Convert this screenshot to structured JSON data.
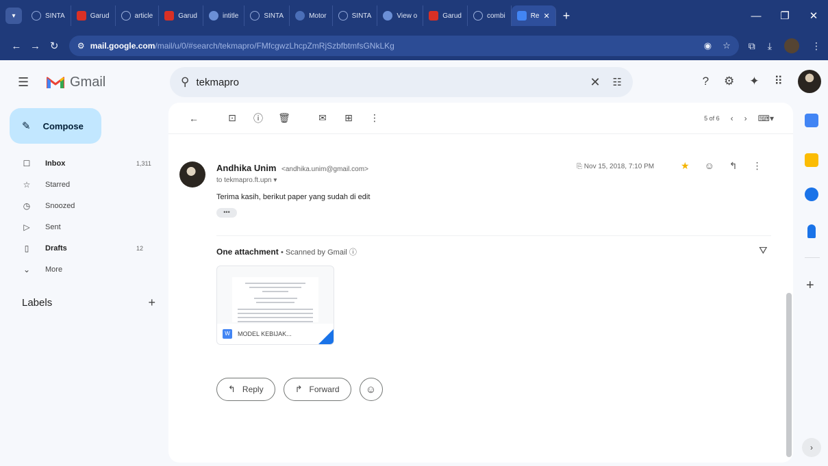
{
  "browser": {
    "tabs": [
      {
        "label": "SINTA",
        "icon": "sinta"
      },
      {
        "label": "Garud",
        "icon": "garuda"
      },
      {
        "label": "article",
        "icon": "art"
      },
      {
        "label": "Garud",
        "icon": "garuda"
      },
      {
        "label": "intitle",
        "icon": "web"
      },
      {
        "label": "SINTA",
        "icon": "sinta"
      },
      {
        "label": "Motor",
        "icon": "moto"
      },
      {
        "label": "SINTA",
        "icon": "sinta"
      },
      {
        "label": "View o",
        "icon": "web"
      },
      {
        "label": "Garud",
        "icon": "garuda"
      },
      {
        "label": "combi",
        "icon": "art"
      }
    ],
    "active_tab": {
      "label": "Re"
    },
    "url_host": "mail.google.com",
    "url_path": "/mail/u/0/#search/tekmapro/FMfcgwzLhcpZmRjSzbfbtmfsGNkLKg"
  },
  "gmail": {
    "logo_text": "Gmail",
    "search_value": "tekmapro",
    "compose_label": "Compose",
    "nav": [
      {
        "icon": "inbox-icon",
        "glyph": "☐",
        "label": "Inbox",
        "count": "1,311",
        "bold": true
      },
      {
        "icon": "star-icon",
        "glyph": "☆",
        "label": "Starred",
        "count": "",
        "bold": false
      },
      {
        "icon": "clock-icon",
        "glyph": "◷",
        "label": "Snoozed",
        "count": "",
        "bold": false
      },
      {
        "icon": "send-icon",
        "glyph": "▷",
        "label": "Sent",
        "count": "",
        "bold": false
      },
      {
        "icon": "draft-icon",
        "glyph": "▯",
        "label": "Drafts",
        "count": "12",
        "bold": true
      },
      {
        "icon": "chevron-down-icon",
        "glyph": "⌄",
        "label": "More",
        "count": "",
        "bold": false
      }
    ],
    "labels_heading": "Labels",
    "pager_text": "5 of 6"
  },
  "message": {
    "sender_name": "Andhika Unim",
    "sender_email": "<andhika.unim@gmail.com>",
    "to_line": "to tekmapro.ft.upn",
    "date": "Nov 15, 2018, 7:10 PM",
    "body": "Terima kasih, berikut paper yang sudah di edit",
    "attachment_heading": "One attachment",
    "scanned_text": "Scanned by Gmail",
    "attachment_name": "MODEL KEBIJAK...",
    "reply_label": "Reply",
    "forward_label": "Forward"
  },
  "colors": {
    "chrome": "#1f3a7a",
    "compose_bg": "#c2e7ff",
    "star": "#f4b400"
  }
}
